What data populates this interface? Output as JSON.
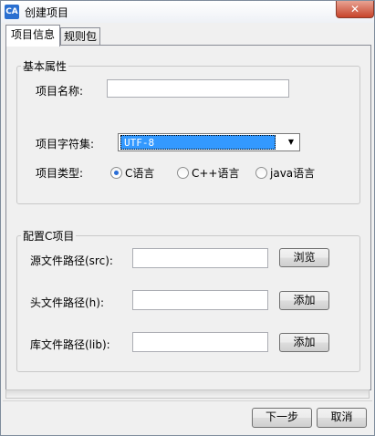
{
  "window": {
    "title": "创建项目",
    "icon_text": "CA"
  },
  "tabs": [
    {
      "label": "项目信息"
    },
    {
      "label": "规则包"
    }
  ],
  "basic": {
    "legend": "基本属性",
    "name_label": "项目名称:",
    "name_value": "",
    "charset_label": "项目字符集:",
    "charset_value": "UTF-8",
    "type_label": "项目类型:",
    "types": [
      {
        "label": "C语言",
        "checked": true
      },
      {
        "label": "C++语言",
        "checked": false
      },
      {
        "label": "java语言",
        "checked": false
      }
    ]
  },
  "cproject": {
    "legend": "配置C项目",
    "src_label": "源文件路径(src):",
    "src_button": "浏览",
    "h_label": "头文件路径(h):",
    "h_button": "添加",
    "lib_label": "库文件路径(lib):",
    "lib_button": "添加"
  },
  "footer": {
    "next_label": "下一步",
    "cancel_label": "取消"
  },
  "colors": {
    "selection": "#3399ff",
    "close_button": "#c7432a",
    "radio_dot": "#2a6dd6"
  }
}
